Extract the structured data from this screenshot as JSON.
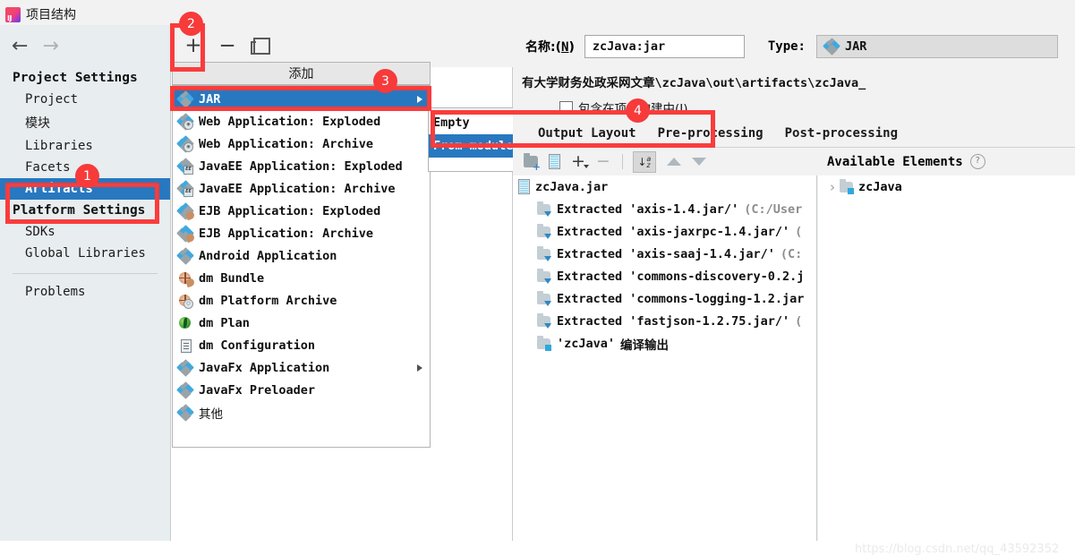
{
  "window": {
    "title": "项目结构",
    "logo_icon": "intellij-idea-logo"
  },
  "topstrip": {
    "fragments": [
      "…",
      "…",
      "…",
      "…",
      "…",
      "…"
    ]
  },
  "nav": {
    "back_icon": "arrow-left-icon",
    "forward_icon": "arrow-right-icon"
  },
  "sidebar": {
    "project_settings_header": "Project Settings",
    "project_items": [
      {
        "label": "Project",
        "selected": false,
        "cjk": false
      },
      {
        "label": "模块",
        "selected": false,
        "cjk": true
      },
      {
        "label": "Libraries",
        "selected": false,
        "cjk": false
      },
      {
        "label": "Facets",
        "selected": false,
        "cjk": false
      },
      {
        "label": "Artifacts",
        "selected": true,
        "cjk": false
      }
    ],
    "platform_settings_header": "Platform Settings",
    "platform_items": [
      {
        "label": "SDKs",
        "selected": false,
        "cjk": false
      },
      {
        "label": "Global Libraries",
        "selected": false,
        "cjk": false
      }
    ],
    "problems_label": "Problems"
  },
  "toolbar": {
    "add_icon": "plus-icon",
    "remove_icon": "minus-icon",
    "copy_icon": "copy-icon"
  },
  "popup": {
    "header": "添加",
    "items": [
      {
        "label": "JAR",
        "icon": "jar-diamond-icon",
        "highlighted": true,
        "has_submenu": true
      },
      {
        "label": "Web Application: Exploded",
        "icon": "web-exploded-icon",
        "highlighted": false,
        "has_submenu": false
      },
      {
        "label": "Web Application: Archive",
        "icon": "web-archive-icon",
        "highlighted": false,
        "has_submenu": false
      },
      {
        "label": "JavaEE Application: Exploded",
        "icon": "javaee-exploded-icon",
        "highlighted": false,
        "has_submenu": false
      },
      {
        "label": "JavaEE Application: Archive",
        "icon": "javaee-archive-icon",
        "highlighted": false,
        "has_submenu": false
      },
      {
        "label": "EJB Application: Exploded",
        "icon": "ejb-exploded-icon",
        "highlighted": false,
        "has_submenu": false
      },
      {
        "label": "EJB Application: Archive",
        "icon": "ejb-archive-icon",
        "highlighted": false,
        "has_submenu": false
      },
      {
        "label": "Android Application",
        "icon": "android-application-icon",
        "highlighted": false,
        "has_submenu": false
      },
      {
        "label": "dm Bundle",
        "icon": "dm-bundle-icon",
        "highlighted": false,
        "has_submenu": false
      },
      {
        "label": "dm Platform Archive",
        "icon": "dm-platform-archive-icon",
        "highlighted": false,
        "has_submenu": false
      },
      {
        "label": "dm Plan",
        "icon": "dm-plan-icon",
        "highlighted": false,
        "has_submenu": false
      },
      {
        "label": "dm Configuration",
        "icon": "dm-configuration-icon",
        "highlighted": false,
        "has_submenu": false
      },
      {
        "label": "JavaFx Application",
        "icon": "javafx-application-icon",
        "highlighted": false,
        "has_submenu": true
      },
      {
        "label": "JavaFx Preloader",
        "icon": "javafx-preloader-icon",
        "highlighted": false,
        "has_submenu": false
      },
      {
        "label": "其他",
        "icon": "other-icon",
        "highlighted": false,
        "has_submenu": false,
        "cjk": true
      }
    ]
  },
  "submenu": {
    "items": [
      {
        "label": "Empty",
        "highlighted": false
      },
      {
        "label": "From modules with dependencies...",
        "highlighted": true
      }
    ]
  },
  "detail": {
    "name_label": "名称:(",
    "name_mnemonic": "N",
    "name_label_end": ")",
    "name_value": "zcJava:jar",
    "type_label": "Type:",
    "type_value": "JAR",
    "type_icon": "jar-diamond-icon",
    "output_directory": "有大学财务处政采网文章\\zcJava\\out\\artifacts\\zcJava_",
    "checkbox_label": "包含在项目构建中(I)",
    "checkbox_checked": false,
    "tabs": [
      {
        "label": "Output Layout",
        "active": true
      },
      {
        "label": "Pre-processing",
        "active": false
      },
      {
        "label": "Post-processing",
        "active": false
      }
    ]
  },
  "tree_toolbar": {
    "add_directory_icon": "folder-add-icon",
    "add_archive_icon": "jar-archive-icon",
    "add_copy_icon": "plus-dropdown-icon",
    "remove_icon": "minus-icon",
    "sort_icon": "sort-az-icon",
    "move_up_icon": "arrow-up-icon",
    "move_down_icon": "arrow-down-icon"
  },
  "output_tree": {
    "rows": [
      {
        "level": 0,
        "icon": "jar-archive-icon",
        "label": "zcJava.jar",
        "detail": ""
      },
      {
        "level": 1,
        "icon": "extracted-directory-icon",
        "label": "Extracted 'axis-1.4.jar/'",
        "detail": "(C:/User"
      },
      {
        "level": 1,
        "icon": "extracted-directory-icon",
        "label": "Extracted 'axis-jaxrpc-1.4.jar/'",
        "detail": "("
      },
      {
        "level": 1,
        "icon": "extracted-directory-icon",
        "label": "Extracted 'axis-saaj-1.4.jar/'",
        "detail": "(C:"
      },
      {
        "level": 1,
        "icon": "extracted-directory-icon",
        "label": "Extracted 'commons-discovery-0.2.j",
        "detail": ""
      },
      {
        "level": 1,
        "icon": "extracted-directory-icon",
        "label": "Extracted 'commons-logging-1.2.jar",
        "detail": ""
      },
      {
        "level": 1,
        "icon": "extracted-directory-icon",
        "label": "Extracted 'fastjson-1.2.75.jar/'",
        "detail": "("
      },
      {
        "level": 1,
        "icon": "module-output-icon",
        "label": "'zcJava'",
        "detail_cjk": "编译输出"
      }
    ]
  },
  "available": {
    "header": "Available Elements",
    "help_icon": "help-circle-icon",
    "rows": [
      {
        "chevron": "›",
        "icon": "module-output-icon",
        "label": "zcJava"
      }
    ]
  },
  "watermark": "https://blog.csdn.net/qq_43592352",
  "annotations": {
    "accent_color": "#f73a3a",
    "badges": [
      {
        "number": "1"
      },
      {
        "number": "2"
      },
      {
        "number": "3"
      },
      {
        "number": "4"
      }
    ]
  }
}
